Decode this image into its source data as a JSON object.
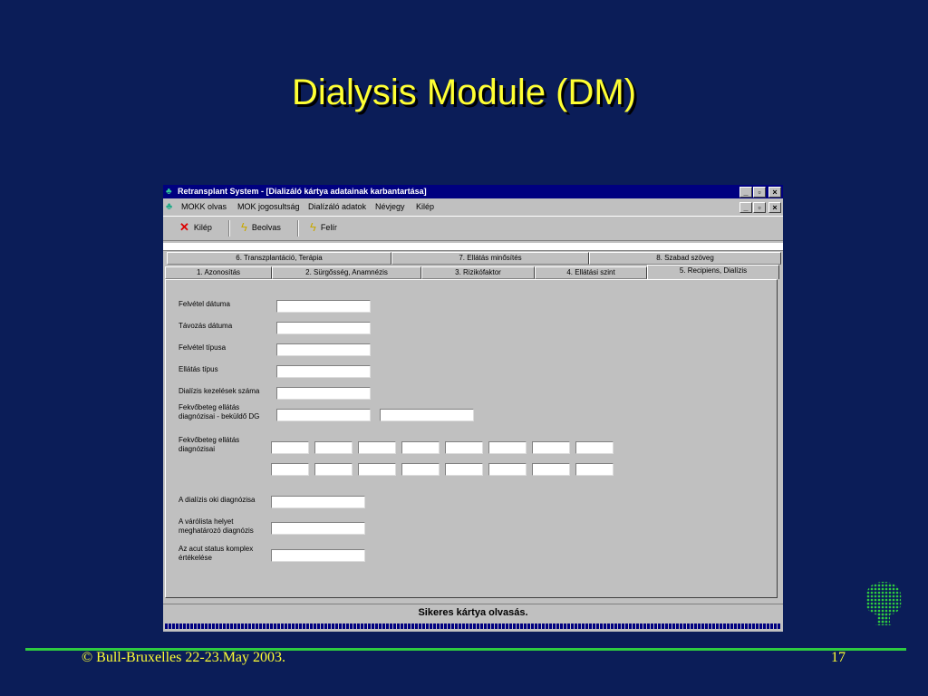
{
  "slide": {
    "title": "Dialysis Module (DM)",
    "footer": "© Bull-Bruxelles 22-23.May 2003.",
    "page_number": "17"
  },
  "window": {
    "title": "Retransplant System - [Dializáló kártya adatainak karbantartása]",
    "controls": [
      "_",
      "▫",
      "×"
    ],
    "icon": "tree-icon"
  },
  "menu": {
    "items": [
      "MOKK olvas",
      "MOK jogosultság",
      "Dialízáló adatok",
      "Névjegy",
      "Kilép"
    ]
  },
  "toolbar": {
    "buttons": [
      {
        "label": "Kilép",
        "icon": "close-x-icon"
      },
      {
        "label": "Beolvas",
        "icon": "lightning-icon"
      },
      {
        "label": "Felír",
        "icon": "lightning-icon"
      }
    ]
  },
  "tabs": {
    "row_back": [
      "6. Transzplantáció, Terápia",
      "7. Ellátás minősítés",
      "8. Szabad szöveg"
    ],
    "row_front": [
      "1. Azonosítás",
      "2. Sürgősség, Anamnézis",
      "3. Rizikófaktor",
      "4. Ellátási szint",
      "5. Recipiens, Dialízis"
    ],
    "active": "5. Recipiens, Dialízis"
  },
  "form": {
    "labels": [
      "Felvétel dátuma",
      "Távozás dátuma",
      "Felvétel típusa",
      "Ellátás típus",
      "Dialízis kezelések száma",
      "Fekvőbeteg ellátás\ndiagnózisai - beküldő DG",
      "Fekvőbeteg ellátás\ndiagnózisai",
      "A dialízis oki diagnózisa",
      "A várólista helyet\nmeghatározó diagnózis",
      "Az acut status komplex\nértékelése"
    ]
  },
  "status": {
    "message": "Sikeres kártya olvasás."
  }
}
